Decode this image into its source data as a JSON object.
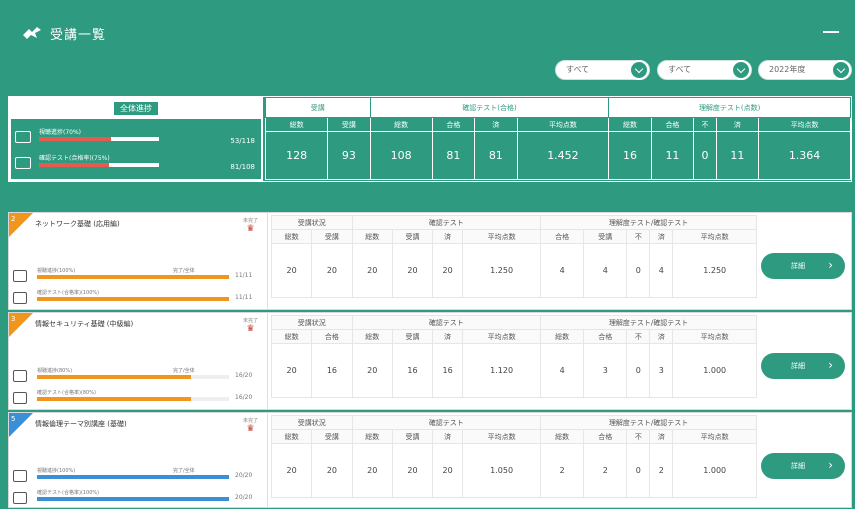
{
  "header": {
    "title": "受講一覧",
    "logo_icon": "bird-logo-icon"
  },
  "filters": [
    {
      "value": "すべて"
    },
    {
      "value": "すべて"
    },
    {
      "value": "2022年度"
    }
  ],
  "summary": {
    "left_title": "全体進捗",
    "rows": [
      {
        "icon": "monitor-icon",
        "label": "視聴進捗(70%)",
        "count": "53/118",
        "progress": 0.6
      },
      {
        "icon": "check-doc-icon",
        "label": "確認テスト(合格率)(75%)",
        "count": "81/108",
        "progress": 0.58
      }
    ],
    "groups": [
      "受講",
      "確認テスト(合格)",
      "理解度テスト(点数)"
    ],
    "subheaders": [
      "総数",
      "受講",
      "総数",
      "合格",
      "済",
      "平均点数",
      "総数",
      "合格",
      "不",
      "済",
      "平均点数"
    ],
    "values": [
      "128",
      "93",
      "108",
      "81",
      "81",
      "1.452",
      "16",
      "11",
      "0",
      "11",
      "1.364"
    ]
  },
  "courses": [
    {
      "num": "2",
      "color": "#f0961e",
      "title": "ネットワーク基礎 (応用編)",
      "badge_label": "未完了",
      "rows": [
        {
          "label": "視聴進捗(100%)",
          "tag": "完了/全体",
          "count": "11/11",
          "progress": 1.0,
          "icon": "monitor-icon"
        },
        {
          "label": "確認テスト(合格率)(100%)",
          "tag": "",
          "count": "11/11",
          "progress": 1.0,
          "icon": "check-doc-icon"
        }
      ],
      "groups": [
        "受講状況",
        "確認テスト",
        "理解度テスト/確認テスト"
      ],
      "subheaders": [
        "総数",
        "受講",
        "総数",
        "受講",
        "済",
        "平均点数",
        "合格",
        "受講",
        "不",
        "済",
        "平均点数"
      ],
      "values": [
        "20",
        "20",
        "20",
        "20",
        "20",
        "1.250",
        "4",
        "4",
        "0",
        "4",
        "1.250"
      ],
      "button": "詳細"
    },
    {
      "num": "3",
      "color": "#f0961e",
      "title": "情報セキュリティ基礎 (中級編)",
      "badge_label": "未完了",
      "rows": [
        {
          "label": "視聴進捗(80%)",
          "tag": "完了/全体",
          "count": "16/20",
          "progress": 0.8,
          "icon": "monitor-icon"
        },
        {
          "label": "確認テスト(合格率)(80%)",
          "tag": "",
          "count": "16/20",
          "progress": 0.8,
          "icon": "check-doc-icon"
        }
      ],
      "groups": [
        "受講状況",
        "確認テスト",
        "理解度テスト/確認テスト"
      ],
      "subheaders": [
        "総数",
        "合格",
        "総数",
        "受講",
        "済",
        "平均点数",
        "総数",
        "合格",
        "不",
        "済",
        "平均点数"
      ],
      "values": [
        "20",
        "16",
        "20",
        "16",
        "16",
        "1.120",
        "4",
        "3",
        "0",
        "3",
        "1.000"
      ],
      "button": "詳細"
    },
    {
      "num": "5",
      "color": "#3b8fd6",
      "title": "情報倫理テーマ別講座 (基礎)",
      "badge_label": "未完了",
      "rows": [
        {
          "label": "視聴進捗(100%)",
          "tag": "完了/全体",
          "count": "20/20",
          "progress": 1.0,
          "icon": "monitor-icon"
        },
        {
          "label": "確認テスト(合格率)(100%)",
          "tag": "",
          "count": "20/20",
          "progress": 1.0,
          "icon": "check-doc-icon"
        }
      ],
      "groups": [
        "受講状況",
        "確認テスト",
        "理解度テスト/確認テスト"
      ],
      "subheaders": [
        "総数",
        "受講",
        "総数",
        "受講",
        "済",
        "平均点数",
        "総数",
        "合格",
        "不",
        "済",
        "平均点数"
      ],
      "values": [
        "20",
        "20",
        "20",
        "20",
        "20",
        "1.050",
        "2",
        "2",
        "0",
        "2",
        "1.000"
      ],
      "button": "詳細"
    }
  ]
}
